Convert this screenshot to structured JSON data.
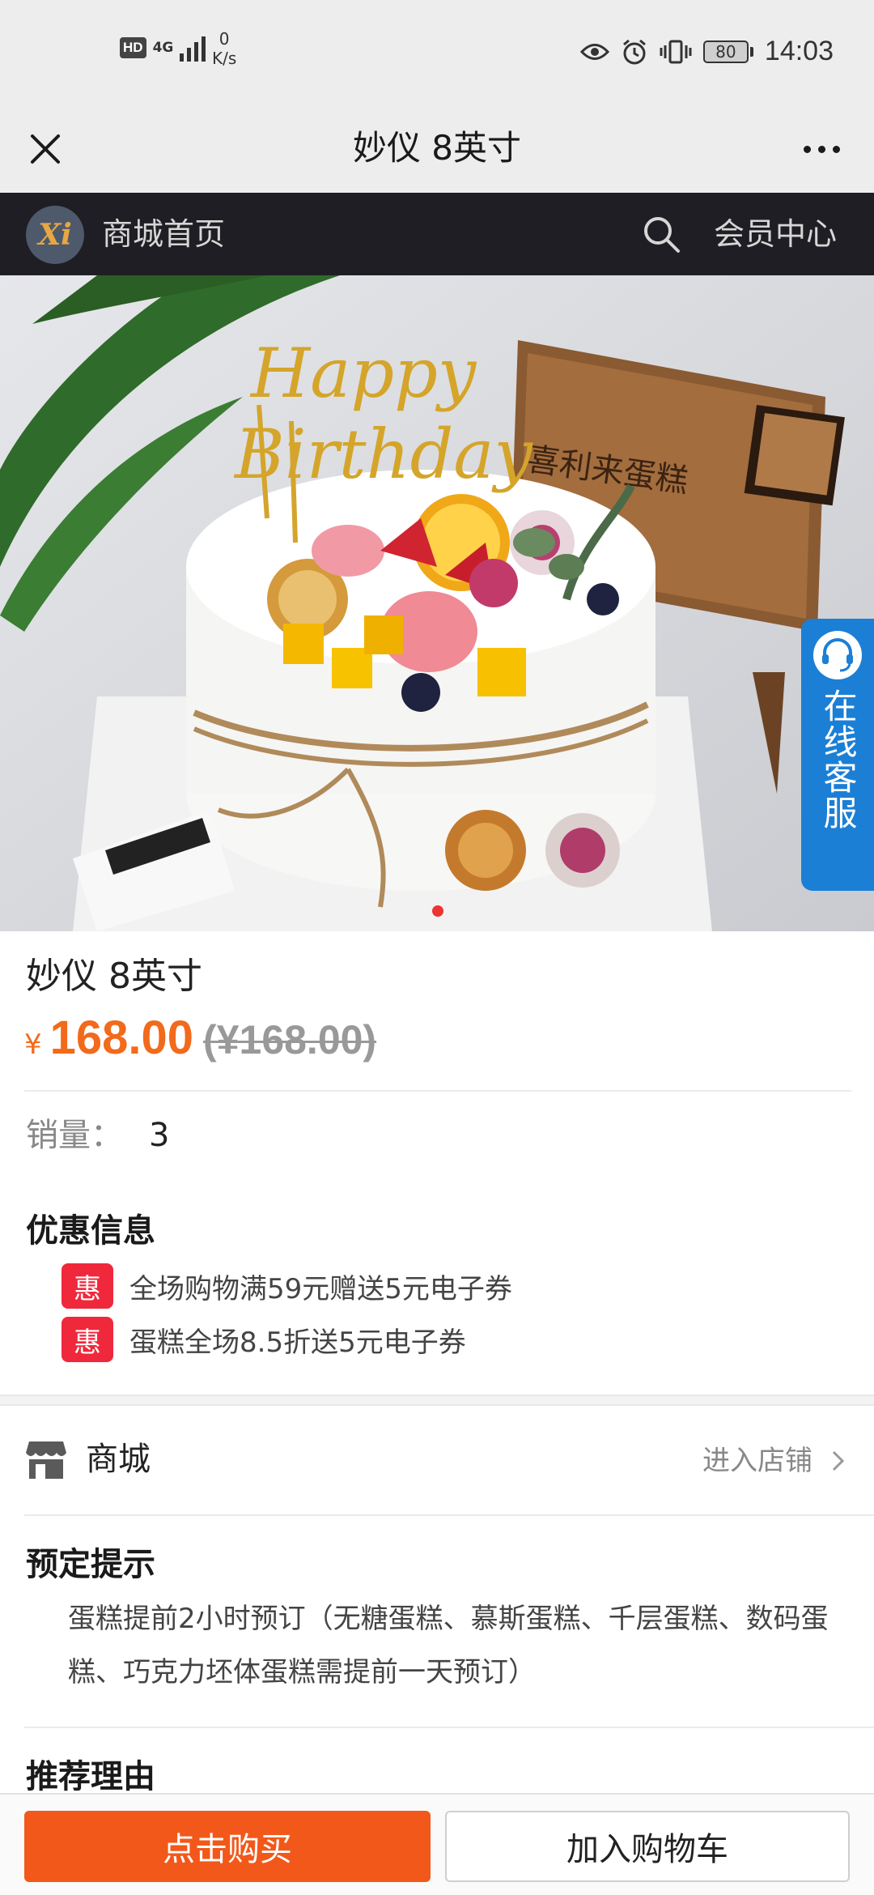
{
  "status_bar": {
    "hd": "HD",
    "network": "4G",
    "speed_value": "0",
    "speed_unit": "K/s",
    "battery": "80",
    "time": "14:03"
  },
  "title_bar": {
    "title": "妙仪 8英寸"
  },
  "shop_header": {
    "logo_text": "Xi",
    "home_label": "商城首页",
    "member_center": "会员中心"
  },
  "product_image": {
    "customer_service_label": "在线客服",
    "colors": {
      "cs_blue": "#1b7fd6",
      "dot_red": "#ee3333"
    }
  },
  "product": {
    "name": "妙仪 8英寸",
    "currency": "¥",
    "price": "168.00",
    "original_price_display": "(¥168.00)",
    "sales_label": "销量：",
    "sales_value": "3"
  },
  "promotions": {
    "title": "优惠信息",
    "items": [
      {
        "badge": "惠",
        "text": "全场购物满59元赠送5元电子券"
      },
      {
        "badge": "惠",
        "text": "蛋糕全场8.5折送5元电子券"
      }
    ]
  },
  "store": {
    "label": "商城",
    "enter_label": "进入店铺"
  },
  "reservation": {
    "title": "预定提示",
    "text": "蛋糕提前2小时预订（无糖蛋糕、慕斯蛋糕、千层蛋糕、数码蛋糕、巧克力坯体蛋糕需提前一天预订）"
  },
  "recommendation": {
    "title": "推荐理由"
  },
  "bottom_bar": {
    "buy_label": "点击购买",
    "cart_label": "加入购物车",
    "colors": {
      "buy": "#f2581a",
      "price": "#f26a1b",
      "promo_badge": "#f0283c"
    }
  }
}
